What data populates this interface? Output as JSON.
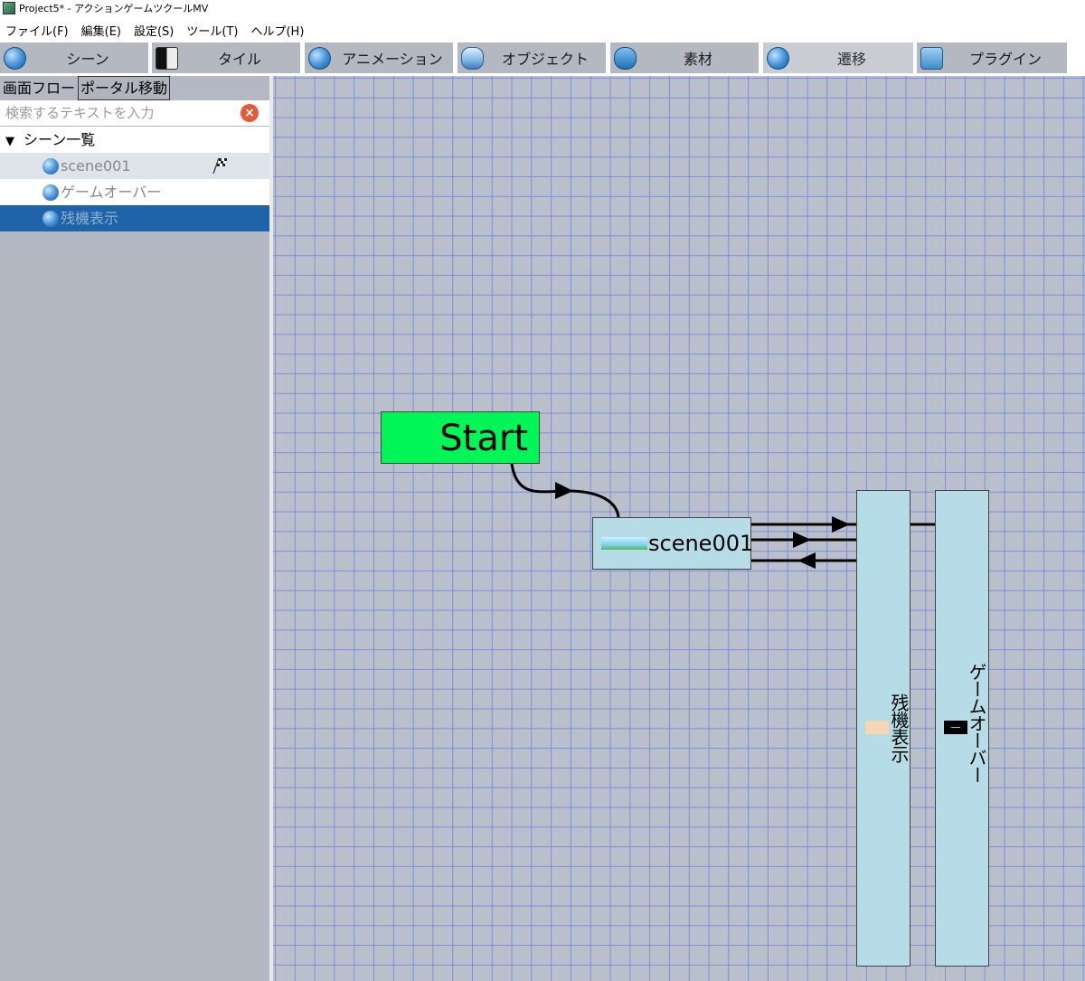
{
  "window": {
    "title": "Project5* - アクションゲームツクールMV"
  },
  "menu": [
    "ファイル(F)",
    "編集(E)",
    "設定(S)",
    "ツール(T)",
    "ヘルプ(H)"
  ],
  "tabs": [
    {
      "label": "シーン",
      "icon": "scene-icon"
    },
    {
      "label": "タイル",
      "icon": "tile-icon"
    },
    {
      "label": "アニメーション",
      "icon": "animation-icon"
    },
    {
      "label": "オブジェクト",
      "icon": "object-icon"
    },
    {
      "label": "素材",
      "icon": "material-icon"
    },
    {
      "label": "遷移",
      "icon": "transition-icon",
      "active": true
    },
    {
      "label": "プラグイン",
      "icon": "plugin-icon"
    }
  ],
  "left_panel": {
    "subtabs": [
      "画面フロー",
      "ポータル移動"
    ],
    "search_placeholder": "検索するテキストを入力",
    "tree_header": "シーン一覧",
    "scenes": [
      {
        "label": "scene001",
        "start": true
      },
      {
        "label": "ゲームオーバー"
      },
      {
        "label": "残機表示",
        "selected": true
      }
    ]
  },
  "canvas": {
    "start_label": "Start",
    "nodes": {
      "scene001": "scene001",
      "zanki": "残機表示",
      "gameover": "ゲームオーバー"
    }
  },
  "colors": {
    "start_node": "#00f657",
    "scene_node": "#b6dce8",
    "selected_row": "#1f63a8",
    "grid_line": "#7b8fd6",
    "canvas_bg": "#b9c0cc"
  }
}
